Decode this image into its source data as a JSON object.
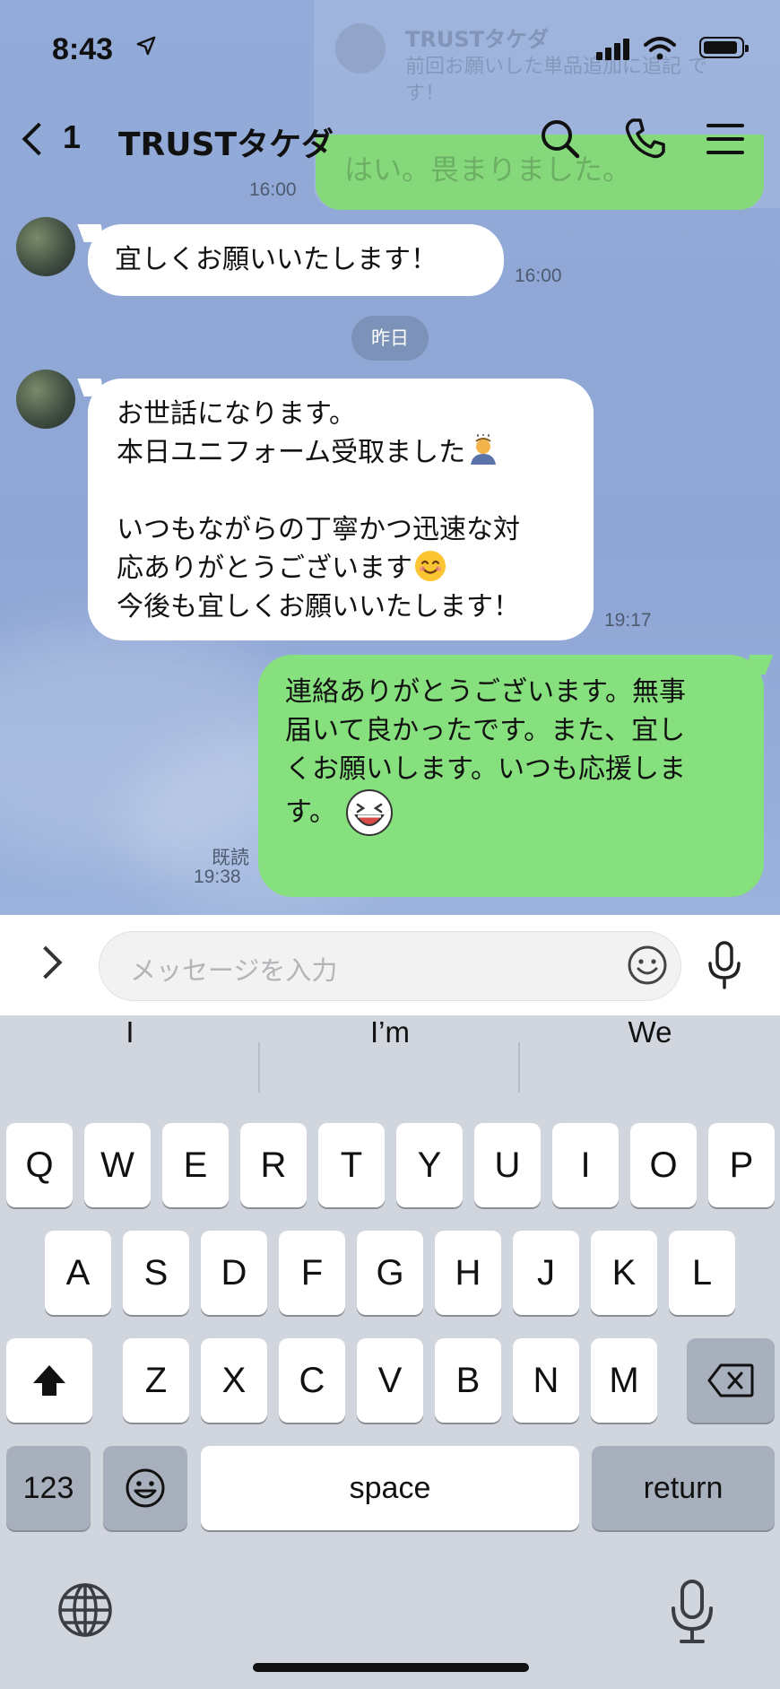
{
  "status_bar": {
    "time": "8:43"
  },
  "notification": {
    "sender": "TRUSTタケダ",
    "preview": "前回お願いした単品追加に追記 です！",
    "reply_preview": "はい。畏まりました。"
  },
  "header": {
    "back_count": "1",
    "title": "TRUSTタケダ"
  },
  "messages": {
    "m0_time": "16:00",
    "m1": {
      "lines": [
        "宜しくお願いいたします！"
      ],
      "time": "16:00"
    },
    "date_separator": "昨日",
    "m2": {
      "lines": [
        "お世話になります。",
        "本日ユニフォーム受取ました",
        "",
        "いつもながらの丁寧かつ迅速な対",
        "応ありがとうございます",
        "今後も宜しくお願いいたします！"
      ],
      "time": "19:17"
    },
    "m3": {
      "lines": [
        "連絡ありがとうございます。無事",
        "届いて良かったです。また、宜し",
        "くお願いします。いつも応援しま",
        "す。"
      ],
      "read": "既読",
      "time": "19:38"
    }
  },
  "input": {
    "placeholder": "メッセージを入力"
  },
  "keyboard": {
    "suggestions": [
      "I",
      "I’m",
      "We"
    ],
    "row1": [
      "Q",
      "W",
      "E",
      "R",
      "T",
      "Y",
      "U",
      "I",
      "O",
      "P"
    ],
    "row2": [
      "A",
      "S",
      "D",
      "F",
      "G",
      "H",
      "J",
      "K",
      "L"
    ],
    "row3": [
      "Z",
      "X",
      "C",
      "V",
      "B",
      "N",
      "M"
    ],
    "numbers_label": "123",
    "space_label": "space",
    "return_label": "return"
  },
  "colors": {
    "chat_bg": "#8fa6d6",
    "outgoing_bubble": "#86e07d",
    "incoming_bubble": "#ffffff",
    "keyboard_bg": "#d1d5dd"
  },
  "icons": [
    "location-arrow-icon",
    "signal-icon",
    "wifi-icon",
    "battery-icon",
    "back-chevron-icon",
    "search-icon",
    "phone-icon",
    "menu-icon",
    "expand-chevron-icon",
    "emoji-icon",
    "mic-icon",
    "shift-icon",
    "backspace-icon",
    "globe-icon"
  ]
}
